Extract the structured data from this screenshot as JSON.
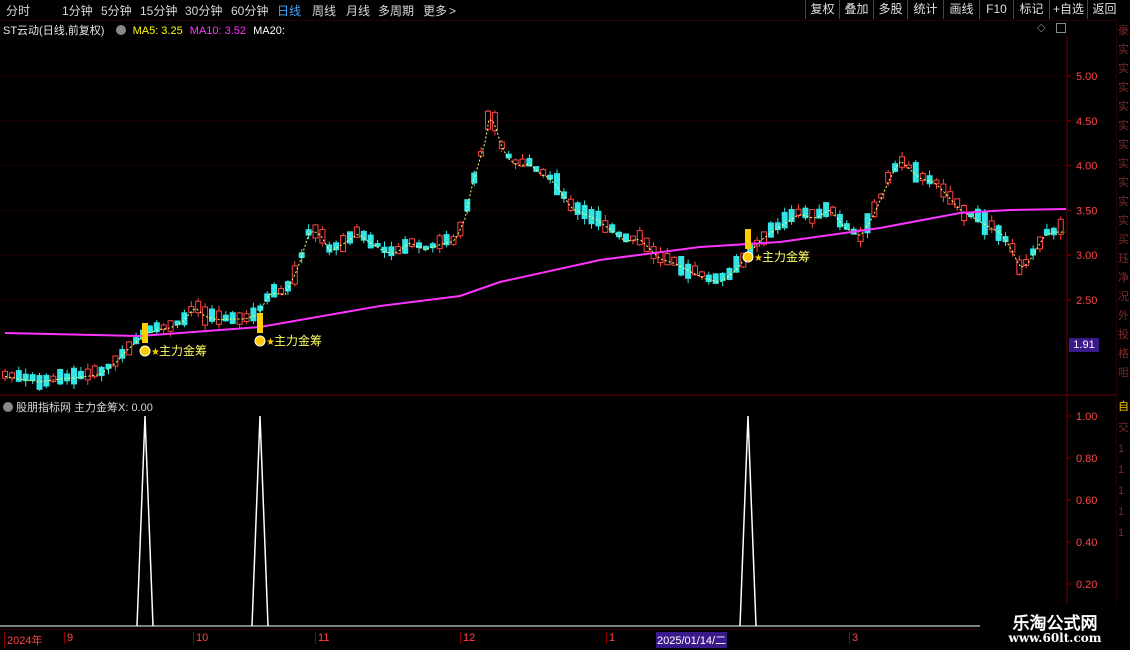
{
  "topbar": {
    "tabs": [
      "分时",
      "1分钟",
      "5分钟",
      "15分钟",
      "30分钟",
      "60分钟",
      "日线",
      "周线",
      "月线",
      "多周期",
      "更多"
    ],
    "active_tab": "日线",
    "more_arrow": ">",
    "right_buttons": [
      "复权",
      "叠加",
      "多股",
      "统计",
      "画线",
      "F10",
      "标记",
      "+自选",
      "返回"
    ]
  },
  "legend": {
    "stock_name": "ST云动(日线,前复权)",
    "ma5": "MA5: 3.25",
    "ma10": "MA10: 3.52",
    "ma20": "MA20:",
    "ma5_color": "#ffff00",
    "ma10_color": "#ff33ff",
    "ma20_color": "#ffffff"
  },
  "price_axis": [
    "5.00",
    "4.50",
    "4.00",
    "3.50",
    "3.00",
    "2.50"
  ],
  "last_price": "1.91",
  "signal_label": "主力金筹",
  "indicator": {
    "legend": "股朋指标网 主力金筹X: 0.00",
    "axis": [
      "1.00",
      "0.80",
      "0.60",
      "0.40",
      "0.20"
    ]
  },
  "date_axis": {
    "labels": [
      "2024年",
      "9",
      "10",
      "11",
      "12",
      "1",
      "3"
    ],
    "highlight": "2025/01/14/二"
  },
  "sidebar_chars": {
    "top": [
      "豪",
      "实",
      "实",
      "实",
      "实",
      "实",
      "实",
      "实",
      "实",
      "实",
      "实",
      "买",
      "珏",
      "净",
      "况",
      "外",
      "投",
      "格",
      "咀"
    ],
    "bottom": [
      "自",
      "交",
      "1",
      "1",
      "1",
      "1",
      "1"
    ]
  },
  "watermark": {
    "line1": "乐淘公式网",
    "line2": "www.60lt.com"
  },
  "chart_data": {
    "type": "candlestick",
    "title": "ST云动(日线,前复权)",
    "price_ticks": [
      2.5,
      3.0,
      3.5,
      4.0,
      4.5,
      5.0
    ],
    "ylim": [
      1.6,
      5.6
    ],
    "last_price": 1.91,
    "ma_legend": {
      "MA5": 3.25,
      "MA10": 3.52
    },
    "signals": [
      {
        "label": "主力金筹"
      },
      {
        "label": "主力金筹"
      },
      {
        "label": "主力金筹"
      }
    ],
    "indicator": {
      "name": "主力金筹X",
      "current": 0.0,
      "ylim": [
        0,
        1.0
      ],
      "spikes": [
        1.0,
        1.0,
        1.0
      ]
    },
    "colors": {
      "up": "#ff4444",
      "down": "#33e5e5",
      "ma_yellow": "#ffff66",
      "ma_magenta": "#ff33ff",
      "signal": "#ffcc00"
    }
  }
}
